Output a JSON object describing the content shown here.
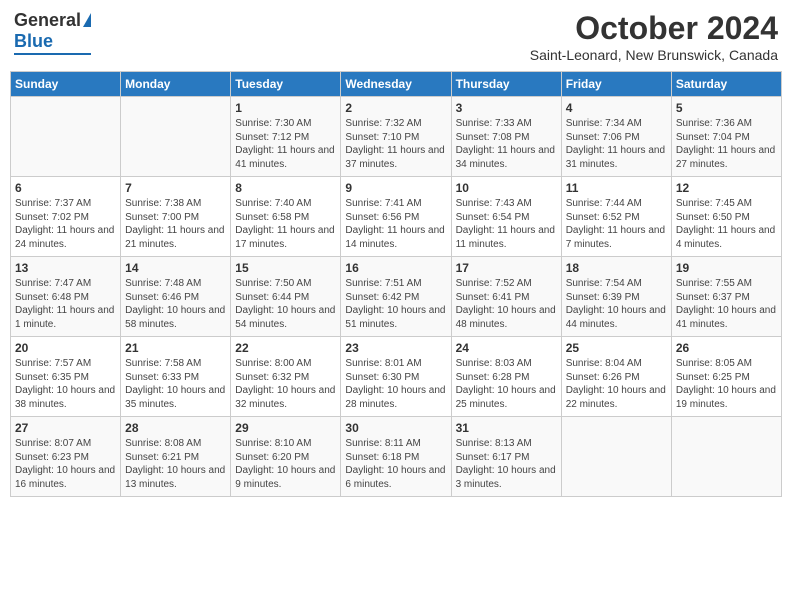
{
  "logo": {
    "general": "General",
    "blue": "Blue"
  },
  "title": "October 2024",
  "location": "Saint-Leonard, New Brunswick, Canada",
  "weekdays": [
    "Sunday",
    "Monday",
    "Tuesday",
    "Wednesday",
    "Thursday",
    "Friday",
    "Saturday"
  ],
  "weeks": [
    [
      {
        "day": null
      },
      {
        "day": null
      },
      {
        "day": "1",
        "sunrise": "Sunrise: 7:30 AM",
        "sunset": "Sunset: 7:12 PM",
        "daylight": "Daylight: 11 hours and 41 minutes."
      },
      {
        "day": "2",
        "sunrise": "Sunrise: 7:32 AM",
        "sunset": "Sunset: 7:10 PM",
        "daylight": "Daylight: 11 hours and 37 minutes."
      },
      {
        "day": "3",
        "sunrise": "Sunrise: 7:33 AM",
        "sunset": "Sunset: 7:08 PM",
        "daylight": "Daylight: 11 hours and 34 minutes."
      },
      {
        "day": "4",
        "sunrise": "Sunrise: 7:34 AM",
        "sunset": "Sunset: 7:06 PM",
        "daylight": "Daylight: 11 hours and 31 minutes."
      },
      {
        "day": "5",
        "sunrise": "Sunrise: 7:36 AM",
        "sunset": "Sunset: 7:04 PM",
        "daylight": "Daylight: 11 hours and 27 minutes."
      }
    ],
    [
      {
        "day": "6",
        "sunrise": "Sunrise: 7:37 AM",
        "sunset": "Sunset: 7:02 PM",
        "daylight": "Daylight: 11 hours and 24 minutes."
      },
      {
        "day": "7",
        "sunrise": "Sunrise: 7:38 AM",
        "sunset": "Sunset: 7:00 PM",
        "daylight": "Daylight: 11 hours and 21 minutes."
      },
      {
        "day": "8",
        "sunrise": "Sunrise: 7:40 AM",
        "sunset": "Sunset: 6:58 PM",
        "daylight": "Daylight: 11 hours and 17 minutes."
      },
      {
        "day": "9",
        "sunrise": "Sunrise: 7:41 AM",
        "sunset": "Sunset: 6:56 PM",
        "daylight": "Daylight: 11 hours and 14 minutes."
      },
      {
        "day": "10",
        "sunrise": "Sunrise: 7:43 AM",
        "sunset": "Sunset: 6:54 PM",
        "daylight": "Daylight: 11 hours and 11 minutes."
      },
      {
        "day": "11",
        "sunrise": "Sunrise: 7:44 AM",
        "sunset": "Sunset: 6:52 PM",
        "daylight": "Daylight: 11 hours and 7 minutes."
      },
      {
        "day": "12",
        "sunrise": "Sunrise: 7:45 AM",
        "sunset": "Sunset: 6:50 PM",
        "daylight": "Daylight: 11 hours and 4 minutes."
      }
    ],
    [
      {
        "day": "13",
        "sunrise": "Sunrise: 7:47 AM",
        "sunset": "Sunset: 6:48 PM",
        "daylight": "Daylight: 11 hours and 1 minute."
      },
      {
        "day": "14",
        "sunrise": "Sunrise: 7:48 AM",
        "sunset": "Sunset: 6:46 PM",
        "daylight": "Daylight: 10 hours and 58 minutes."
      },
      {
        "day": "15",
        "sunrise": "Sunrise: 7:50 AM",
        "sunset": "Sunset: 6:44 PM",
        "daylight": "Daylight: 10 hours and 54 minutes."
      },
      {
        "day": "16",
        "sunrise": "Sunrise: 7:51 AM",
        "sunset": "Sunset: 6:42 PM",
        "daylight": "Daylight: 10 hours and 51 minutes."
      },
      {
        "day": "17",
        "sunrise": "Sunrise: 7:52 AM",
        "sunset": "Sunset: 6:41 PM",
        "daylight": "Daylight: 10 hours and 48 minutes."
      },
      {
        "day": "18",
        "sunrise": "Sunrise: 7:54 AM",
        "sunset": "Sunset: 6:39 PM",
        "daylight": "Daylight: 10 hours and 44 minutes."
      },
      {
        "day": "19",
        "sunrise": "Sunrise: 7:55 AM",
        "sunset": "Sunset: 6:37 PM",
        "daylight": "Daylight: 10 hours and 41 minutes."
      }
    ],
    [
      {
        "day": "20",
        "sunrise": "Sunrise: 7:57 AM",
        "sunset": "Sunset: 6:35 PM",
        "daylight": "Daylight: 10 hours and 38 minutes."
      },
      {
        "day": "21",
        "sunrise": "Sunrise: 7:58 AM",
        "sunset": "Sunset: 6:33 PM",
        "daylight": "Daylight: 10 hours and 35 minutes."
      },
      {
        "day": "22",
        "sunrise": "Sunrise: 8:00 AM",
        "sunset": "Sunset: 6:32 PM",
        "daylight": "Daylight: 10 hours and 32 minutes."
      },
      {
        "day": "23",
        "sunrise": "Sunrise: 8:01 AM",
        "sunset": "Sunset: 6:30 PM",
        "daylight": "Daylight: 10 hours and 28 minutes."
      },
      {
        "day": "24",
        "sunrise": "Sunrise: 8:03 AM",
        "sunset": "Sunset: 6:28 PM",
        "daylight": "Daylight: 10 hours and 25 minutes."
      },
      {
        "day": "25",
        "sunrise": "Sunrise: 8:04 AM",
        "sunset": "Sunset: 6:26 PM",
        "daylight": "Daylight: 10 hours and 22 minutes."
      },
      {
        "day": "26",
        "sunrise": "Sunrise: 8:05 AM",
        "sunset": "Sunset: 6:25 PM",
        "daylight": "Daylight: 10 hours and 19 minutes."
      }
    ],
    [
      {
        "day": "27",
        "sunrise": "Sunrise: 8:07 AM",
        "sunset": "Sunset: 6:23 PM",
        "daylight": "Daylight: 10 hours and 16 minutes."
      },
      {
        "day": "28",
        "sunrise": "Sunrise: 8:08 AM",
        "sunset": "Sunset: 6:21 PM",
        "daylight": "Daylight: 10 hours and 13 minutes."
      },
      {
        "day": "29",
        "sunrise": "Sunrise: 8:10 AM",
        "sunset": "Sunset: 6:20 PM",
        "daylight": "Daylight: 10 hours and 9 minutes."
      },
      {
        "day": "30",
        "sunrise": "Sunrise: 8:11 AM",
        "sunset": "Sunset: 6:18 PM",
        "daylight": "Daylight: 10 hours and 6 minutes."
      },
      {
        "day": "31",
        "sunrise": "Sunrise: 8:13 AM",
        "sunset": "Sunset: 6:17 PM",
        "daylight": "Daylight: 10 hours and 3 minutes."
      },
      {
        "day": null
      },
      {
        "day": null
      }
    ]
  ]
}
